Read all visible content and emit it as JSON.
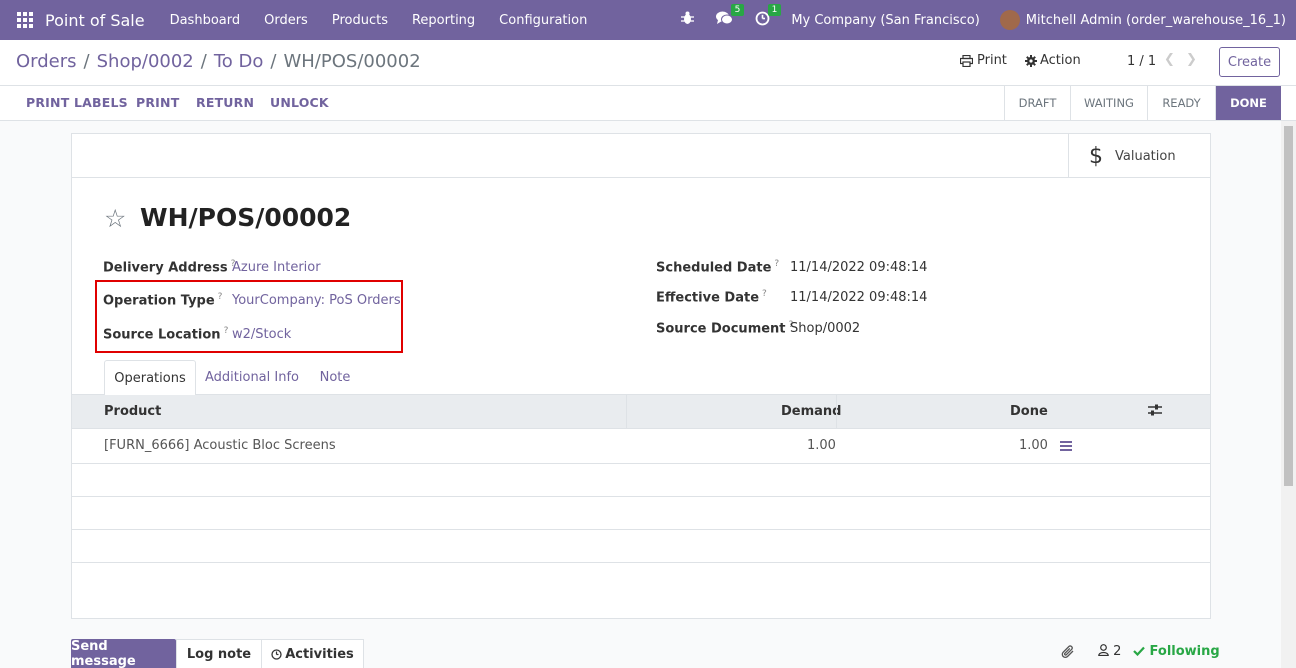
{
  "navbar": {
    "app_name": "Point of Sale",
    "menu": [
      "Dashboard",
      "Orders",
      "Products",
      "Reporting",
      "Configuration"
    ],
    "messages_badge": "5",
    "activities_badge": "1",
    "company": "My Company (San Francisco)",
    "user": "Mitchell Admin (order_warehouse_16_1)"
  },
  "breadcrumb": {
    "items": [
      "Orders",
      "Shop/0002",
      "To Do"
    ],
    "separator": "/",
    "current": "WH/POS/00002"
  },
  "control": {
    "print_label": "Print",
    "action_label": "Action",
    "pager": "1 / 1",
    "create_label": "Create"
  },
  "statusbar": {
    "buttons": [
      "PRINT LABELS",
      "PRINT",
      "RETURN",
      "UNLOCK"
    ],
    "stages": [
      "DRAFT",
      "WAITING",
      "READY",
      "DONE"
    ],
    "current_stage": "DONE"
  },
  "smart_button": {
    "label": "Valuation",
    "icon": "dollar-icon"
  },
  "record": {
    "title": "WH/POS/00002"
  },
  "fields": {
    "delivery_address_label": "Delivery Address",
    "delivery_address": "Azure Interior",
    "operation_type_label": "Operation Type",
    "operation_type": "YourCompany: PoS Orders",
    "source_location_label": "Source Location",
    "source_location": "w2/Stock",
    "scheduled_date_label": "Scheduled Date",
    "scheduled_date": "11/14/2022 09:48:14",
    "effective_date_label": "Effective Date",
    "effective_date": "11/14/2022 09:48:14",
    "source_document_label": "Source Document",
    "source_document": "Shop/0002",
    "help_marker": "?"
  },
  "tabs": [
    "Operations",
    "Additional Info",
    "Note"
  ],
  "table": {
    "headers": [
      "Product",
      "Demand",
      "Done"
    ],
    "rows": [
      {
        "product": "[FURN_6666] Acoustic Bloc Screens",
        "demand": "1.00",
        "done": "1.00"
      }
    ]
  },
  "chatter": {
    "send_message": "Send message",
    "log_note": "Log note",
    "activities": "Activities",
    "followers_count": "2",
    "following": "Following"
  },
  "colors": {
    "brand": "#71639e",
    "highlight": "#e00000",
    "success": "#28a745"
  }
}
